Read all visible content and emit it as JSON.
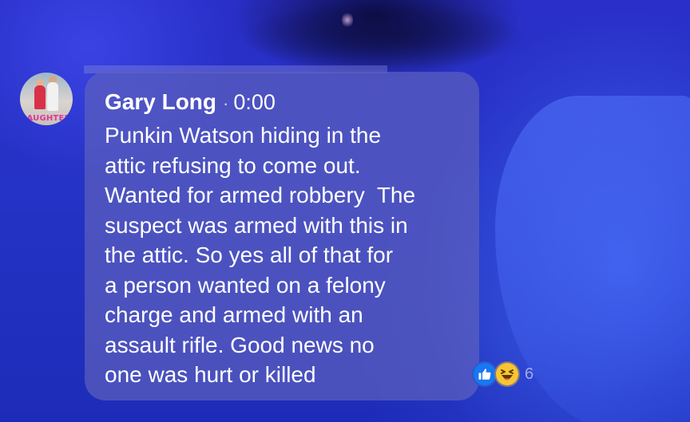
{
  "comment": {
    "author": "Gary Long",
    "separator": "·",
    "timestamp": "0:00",
    "text": "Punkin Watson hiding in the\nattic refusing to come out.\nWanted for armed robbery  The\nsuspect was armed with this in\nthe attic. So yes all of that for\na person wanted on a felony\ncharge and armed with an\nassault rifle. Good news no\none was hurt or killed",
    "avatar_caption": "DAUGHTERS",
    "reactions": {
      "icons": [
        "like-icon",
        "haha-icon"
      ],
      "count": "6"
    }
  },
  "colors": {
    "bubble": "#5c60be",
    "like": "#1877f2",
    "haha": "#f7c533",
    "text": "#ffffff"
  }
}
